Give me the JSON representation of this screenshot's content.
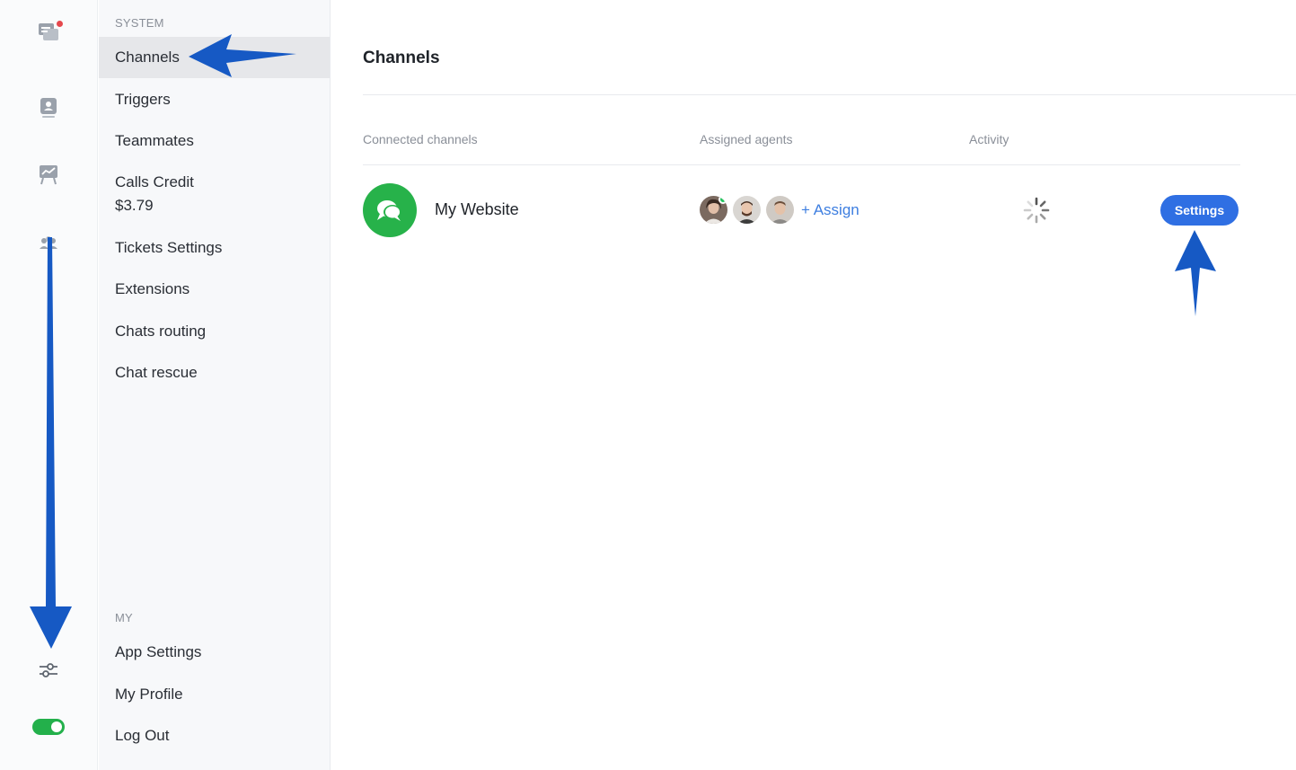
{
  "rail": {
    "icons": [
      "chat-bubbles-icon",
      "contact-card-icon",
      "analytics-board-icon",
      "people-icon",
      "sliders-icon"
    ],
    "notification": true,
    "status_toggle_on": true
  },
  "subnav": {
    "system_label": "SYSTEM",
    "items": [
      {
        "label": "Channels",
        "active": true
      },
      {
        "label": "Triggers"
      },
      {
        "label": "Teammates"
      },
      {
        "label": "Calls Credit",
        "sub": "$3.79"
      },
      {
        "label": "Tickets Settings"
      },
      {
        "label": "Extensions"
      },
      {
        "label": "Chats routing"
      },
      {
        "label": "Chat rescue"
      }
    ],
    "my_label": "MY",
    "my_items": [
      {
        "label": "App Settings"
      },
      {
        "label": "My Profile"
      },
      {
        "label": "Log Out"
      }
    ]
  },
  "main": {
    "title": "Channels",
    "columns": [
      "Connected channels",
      "Assigned agents",
      "Activity"
    ],
    "channel": {
      "name": "My Website",
      "assign_label": "+ Assign",
      "settings_label": "Settings",
      "agents": [
        "agent-avatar-1",
        "agent-avatar-2",
        "agent-avatar-3"
      ]
    }
  },
  "colors": {
    "accent": "#2f6fe3",
    "channel_green": "#27b24a",
    "annotation_arrow": "#1659c4",
    "toggle_green": "#23b04b"
  }
}
